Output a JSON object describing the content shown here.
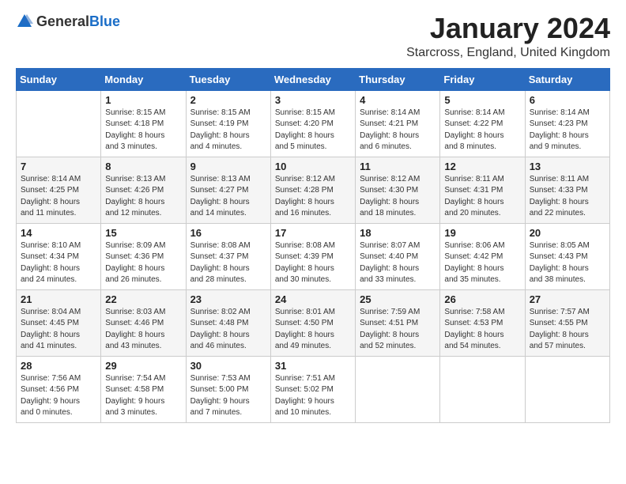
{
  "logo": {
    "text_general": "General",
    "text_blue": "Blue"
  },
  "header": {
    "title": "January 2024",
    "subtitle": "Starcross, England, United Kingdom"
  },
  "weekdays": [
    "Sunday",
    "Monday",
    "Tuesday",
    "Wednesday",
    "Thursday",
    "Friday",
    "Saturday"
  ],
  "weeks": [
    [
      {
        "day": "",
        "info": ""
      },
      {
        "day": "1",
        "info": "Sunrise: 8:15 AM\nSunset: 4:18 PM\nDaylight: 8 hours\nand 3 minutes."
      },
      {
        "day": "2",
        "info": "Sunrise: 8:15 AM\nSunset: 4:19 PM\nDaylight: 8 hours\nand 4 minutes."
      },
      {
        "day": "3",
        "info": "Sunrise: 8:15 AM\nSunset: 4:20 PM\nDaylight: 8 hours\nand 5 minutes."
      },
      {
        "day": "4",
        "info": "Sunrise: 8:14 AM\nSunset: 4:21 PM\nDaylight: 8 hours\nand 6 minutes."
      },
      {
        "day": "5",
        "info": "Sunrise: 8:14 AM\nSunset: 4:22 PM\nDaylight: 8 hours\nand 8 minutes."
      },
      {
        "day": "6",
        "info": "Sunrise: 8:14 AM\nSunset: 4:23 PM\nDaylight: 8 hours\nand 9 minutes."
      }
    ],
    [
      {
        "day": "7",
        "info": "Sunrise: 8:14 AM\nSunset: 4:25 PM\nDaylight: 8 hours\nand 11 minutes."
      },
      {
        "day": "8",
        "info": "Sunrise: 8:13 AM\nSunset: 4:26 PM\nDaylight: 8 hours\nand 12 minutes."
      },
      {
        "day": "9",
        "info": "Sunrise: 8:13 AM\nSunset: 4:27 PM\nDaylight: 8 hours\nand 14 minutes."
      },
      {
        "day": "10",
        "info": "Sunrise: 8:12 AM\nSunset: 4:28 PM\nDaylight: 8 hours\nand 16 minutes."
      },
      {
        "day": "11",
        "info": "Sunrise: 8:12 AM\nSunset: 4:30 PM\nDaylight: 8 hours\nand 18 minutes."
      },
      {
        "day": "12",
        "info": "Sunrise: 8:11 AM\nSunset: 4:31 PM\nDaylight: 8 hours\nand 20 minutes."
      },
      {
        "day": "13",
        "info": "Sunrise: 8:11 AM\nSunset: 4:33 PM\nDaylight: 8 hours\nand 22 minutes."
      }
    ],
    [
      {
        "day": "14",
        "info": "Sunrise: 8:10 AM\nSunset: 4:34 PM\nDaylight: 8 hours\nand 24 minutes."
      },
      {
        "day": "15",
        "info": "Sunrise: 8:09 AM\nSunset: 4:36 PM\nDaylight: 8 hours\nand 26 minutes."
      },
      {
        "day": "16",
        "info": "Sunrise: 8:08 AM\nSunset: 4:37 PM\nDaylight: 8 hours\nand 28 minutes."
      },
      {
        "day": "17",
        "info": "Sunrise: 8:08 AM\nSunset: 4:39 PM\nDaylight: 8 hours\nand 30 minutes."
      },
      {
        "day": "18",
        "info": "Sunrise: 8:07 AM\nSunset: 4:40 PM\nDaylight: 8 hours\nand 33 minutes."
      },
      {
        "day": "19",
        "info": "Sunrise: 8:06 AM\nSunset: 4:42 PM\nDaylight: 8 hours\nand 35 minutes."
      },
      {
        "day": "20",
        "info": "Sunrise: 8:05 AM\nSunset: 4:43 PM\nDaylight: 8 hours\nand 38 minutes."
      }
    ],
    [
      {
        "day": "21",
        "info": "Sunrise: 8:04 AM\nSunset: 4:45 PM\nDaylight: 8 hours\nand 41 minutes."
      },
      {
        "day": "22",
        "info": "Sunrise: 8:03 AM\nSunset: 4:46 PM\nDaylight: 8 hours\nand 43 minutes."
      },
      {
        "day": "23",
        "info": "Sunrise: 8:02 AM\nSunset: 4:48 PM\nDaylight: 8 hours\nand 46 minutes."
      },
      {
        "day": "24",
        "info": "Sunrise: 8:01 AM\nSunset: 4:50 PM\nDaylight: 8 hours\nand 49 minutes."
      },
      {
        "day": "25",
        "info": "Sunrise: 7:59 AM\nSunset: 4:51 PM\nDaylight: 8 hours\nand 52 minutes."
      },
      {
        "day": "26",
        "info": "Sunrise: 7:58 AM\nSunset: 4:53 PM\nDaylight: 8 hours\nand 54 minutes."
      },
      {
        "day": "27",
        "info": "Sunrise: 7:57 AM\nSunset: 4:55 PM\nDaylight: 8 hours\nand 57 minutes."
      }
    ],
    [
      {
        "day": "28",
        "info": "Sunrise: 7:56 AM\nSunset: 4:56 PM\nDaylight: 9 hours\nand 0 minutes."
      },
      {
        "day": "29",
        "info": "Sunrise: 7:54 AM\nSunset: 4:58 PM\nDaylight: 9 hours\nand 3 minutes."
      },
      {
        "day": "30",
        "info": "Sunrise: 7:53 AM\nSunset: 5:00 PM\nDaylight: 9 hours\nand 7 minutes."
      },
      {
        "day": "31",
        "info": "Sunrise: 7:51 AM\nSunset: 5:02 PM\nDaylight: 9 hours\nand 10 minutes."
      },
      {
        "day": "",
        "info": ""
      },
      {
        "day": "",
        "info": ""
      },
      {
        "day": "",
        "info": ""
      }
    ]
  ]
}
